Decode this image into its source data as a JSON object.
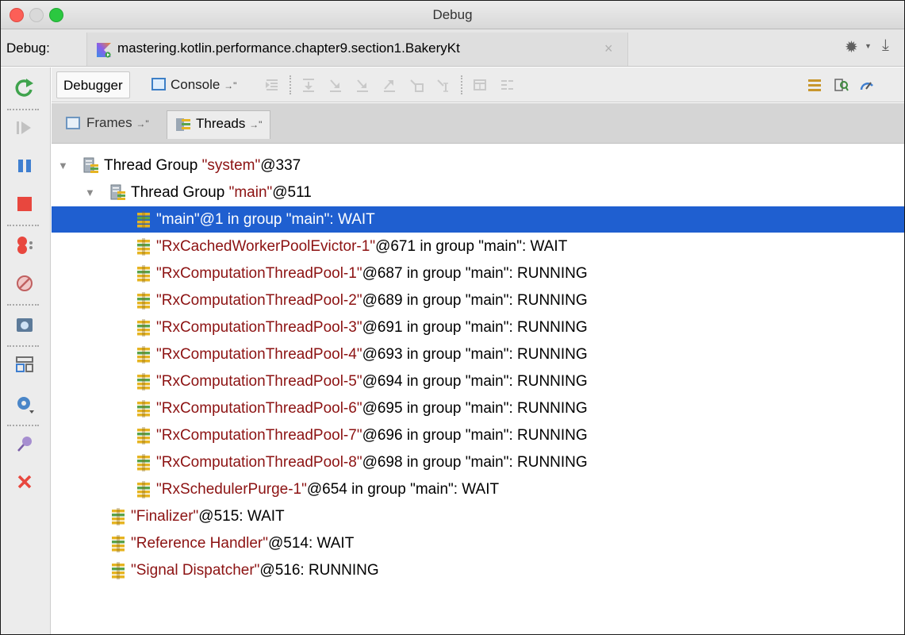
{
  "window": {
    "title": "Debug"
  },
  "debug_tabs": {
    "label": "Debug:",
    "run_config": "mastering.kotlin.performance.chapter9.section1.BakeryKt",
    "close_glyph": "×"
  },
  "subtoolbar": {
    "debugger_tab": "Debugger",
    "console_tab": "Console",
    "pin_glyph": "→\""
  },
  "pane_tabs": {
    "frames": "Frames",
    "threads": "Threads",
    "pin_glyph": "→\""
  },
  "colors": {
    "selection": "#1f5fd0",
    "string_literal": "#8c1212",
    "thread_icon_yellow": "#e6b422",
    "stop_red": "#e8473e",
    "resume_green": "#3fa34d"
  },
  "left_toolbar_icons": [
    "rerun-icon",
    "resume-icon",
    "pause-icon",
    "stop-icon",
    "view-breakpoints-icon",
    "mute-breakpoints-icon",
    "get-thread-dump-icon",
    "restore-layout-icon",
    "settings-icon",
    "pin-tab-icon",
    "close-icon"
  ],
  "threads": [
    {
      "level": 0,
      "expanded": true,
      "type": "group",
      "prefix": "Thread Group ",
      "name": "\"system\"",
      "suffix": "@337",
      "selected": false
    },
    {
      "level": 1,
      "expanded": true,
      "type": "group",
      "prefix": "Thread Group ",
      "name": "\"main\"",
      "suffix": "@511",
      "selected": false
    },
    {
      "level": 2,
      "type": "thread",
      "prefix": "",
      "name": "\"main\"",
      "suffix": "@1 in group \"main\": WAIT",
      "selected": true
    },
    {
      "level": 2,
      "type": "thread",
      "prefix": "",
      "name": "\"RxCachedWorkerPoolEvictor-1\"",
      "suffix": "@671 in group \"main\": WAIT",
      "selected": false
    },
    {
      "level": 2,
      "type": "thread",
      "prefix": "",
      "name": "\"RxComputationThreadPool-1\"",
      "suffix": "@687 in group \"main\": RUNNING",
      "selected": false
    },
    {
      "level": 2,
      "type": "thread",
      "prefix": "",
      "name": "\"RxComputationThreadPool-2\"",
      "suffix": "@689 in group \"main\": RUNNING",
      "selected": false
    },
    {
      "level": 2,
      "type": "thread",
      "prefix": "",
      "name": "\"RxComputationThreadPool-3\"",
      "suffix": "@691 in group \"main\": RUNNING",
      "selected": false
    },
    {
      "level": 2,
      "type": "thread",
      "prefix": "",
      "name": "\"RxComputationThreadPool-4\"",
      "suffix": "@693 in group \"main\": RUNNING",
      "selected": false
    },
    {
      "level": 2,
      "type": "thread",
      "prefix": "",
      "name": "\"RxComputationThreadPool-5\"",
      "suffix": "@694 in group \"main\": RUNNING",
      "selected": false
    },
    {
      "level": 2,
      "type": "thread",
      "prefix": "",
      "name": "\"RxComputationThreadPool-6\"",
      "suffix": "@695 in group \"main\": RUNNING",
      "selected": false
    },
    {
      "level": 2,
      "type": "thread",
      "prefix": "",
      "name": "\"RxComputationThreadPool-7\"",
      "suffix": "@696 in group \"main\": RUNNING",
      "selected": false
    },
    {
      "level": 2,
      "type": "thread",
      "prefix": "",
      "name": "\"RxComputationThreadPool-8\"",
      "suffix": "@698 in group \"main\": RUNNING",
      "selected": false
    },
    {
      "level": 2,
      "type": "thread",
      "prefix": "",
      "name": "\"RxSchedulerPurge-1\"",
      "suffix": "@654 in group \"main\": WAIT",
      "selected": false
    },
    {
      "level": 1,
      "type": "thread",
      "prefix": "",
      "name": "\"Finalizer\"",
      "suffix": "@515: WAIT",
      "selected": false
    },
    {
      "level": 1,
      "type": "thread",
      "prefix": "",
      "name": "\"Reference Handler\"",
      "suffix": "@514: WAIT",
      "selected": false
    },
    {
      "level": 1,
      "type": "thread",
      "prefix": "",
      "name": "\"Signal Dispatcher\"",
      "suffix": "@516: RUNNING",
      "selected": false
    }
  ]
}
